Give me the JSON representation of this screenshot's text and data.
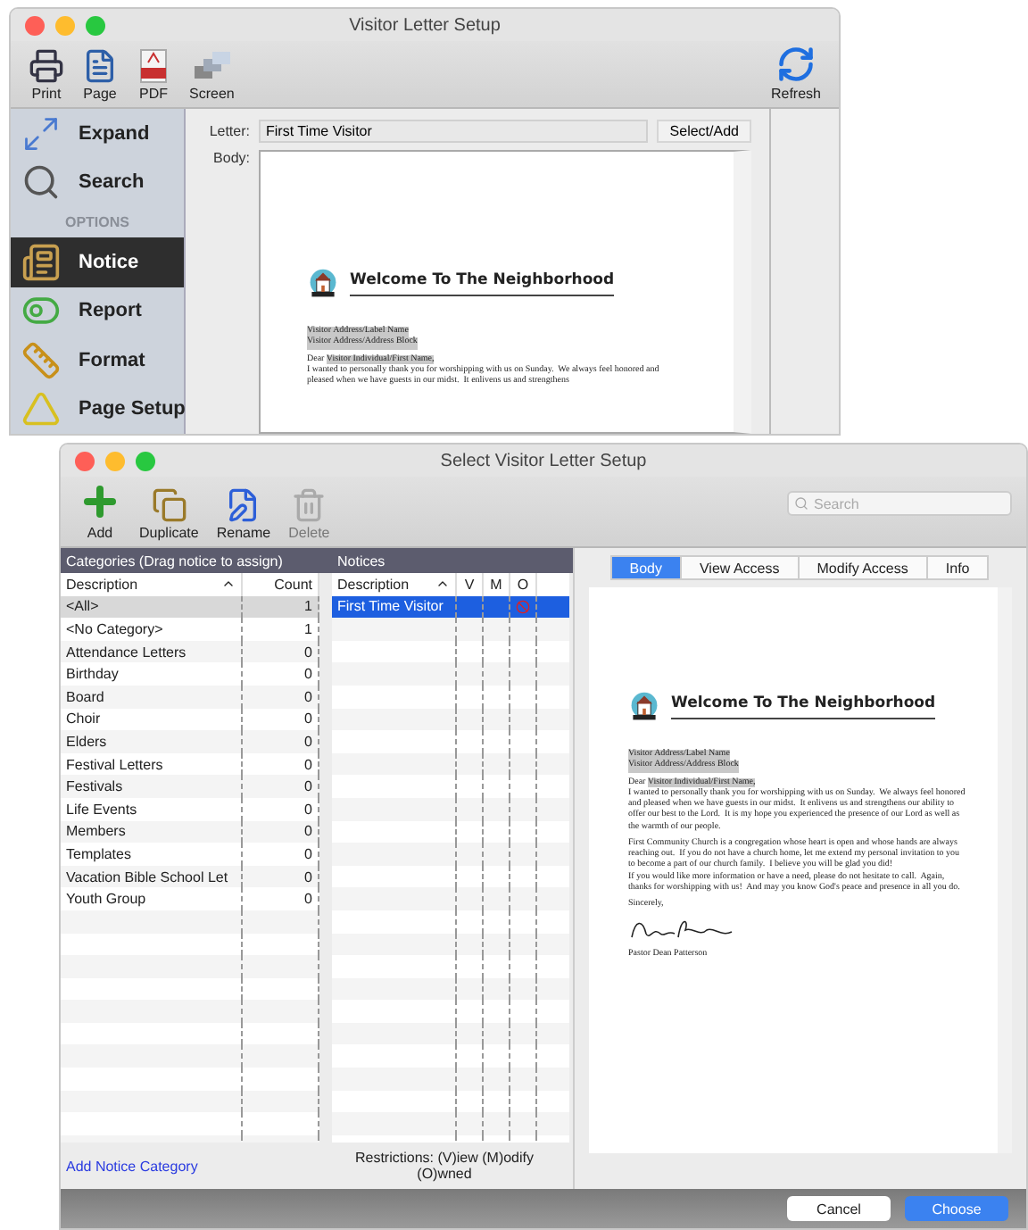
{
  "back_window": {
    "title": "Visitor Letter Setup",
    "toolbar": [
      {
        "label": "Print",
        "kind": "print"
      },
      {
        "label": "Page",
        "kind": "page"
      },
      {
        "label": "PDF",
        "kind": "pdf"
      },
      {
        "label": "Screen",
        "kind": "screen"
      }
    ],
    "refresh": {
      "label": "Refresh"
    },
    "sidebar": [
      {
        "kind": "expand",
        "label": "Expand",
        "selected": false
      },
      {
        "kind": "search",
        "label": "Search",
        "selected": false
      },
      {
        "kind": "header",
        "label": "OPTIONS"
      },
      {
        "kind": "notice",
        "label": "Notice",
        "selected": true
      },
      {
        "kind": "report",
        "label": "Report",
        "selected": false
      },
      {
        "kind": "format",
        "label": "Format",
        "selected": false
      },
      {
        "kind": "pagesetup",
        "label": "Page Setup",
        "selected": false
      }
    ],
    "letter_field": {
      "label": "Letter:",
      "value": "First Time Visitor"
    },
    "select_button": "Select/Add",
    "body_label": "Body:",
    "document": {
      "heading": "Welcome To The Neighborhood",
      "address_lines": [
        "Visitor Address/Label Name",
        "Visitor Address/Address Block"
      ],
      "greeting_prefix": "Dear",
      "greeting_field": "Visitor Individual/First Name,",
      "paragraphs": [
        "I wanted to personally thank you for worshipping with us on Sunday.  We always feel honored and pleased when we have guests in our midst.  It enlivens us and strengthens"
      ]
    }
  },
  "front_window": {
    "title": "Select Visitor Letter Setup",
    "toolbar": [
      {
        "label": "Add",
        "kind": "add",
        "disabled": false
      },
      {
        "label": "Duplicate",
        "kind": "duplicate",
        "disabled": false
      },
      {
        "label": "Rename",
        "kind": "rename",
        "disabled": false
      },
      {
        "label": "Delete",
        "kind": "delete",
        "disabled": true
      }
    ],
    "search": {
      "placeholder": "Search"
    },
    "categories": {
      "header": "Categories (Drag notice to assign)",
      "columns": [
        "Description",
        "Count"
      ],
      "rows": [
        {
          "description": "<All>",
          "count": "1",
          "selected": true
        },
        {
          "description": "<No Category>",
          "count": "1",
          "selected": false
        },
        {
          "description": "Attendance Letters",
          "count": "0",
          "selected": false
        },
        {
          "description": "Birthday",
          "count": "0",
          "selected": false
        },
        {
          "description": "Board",
          "count": "0",
          "selected": false
        },
        {
          "description": "Choir",
          "count": "0",
          "selected": false
        },
        {
          "description": "Elders",
          "count": "0",
          "selected": false
        },
        {
          "description": "Festival Letters",
          "count": "0",
          "selected": false
        },
        {
          "description": "Festivals",
          "count": "0",
          "selected": false
        },
        {
          "description": "Life Events",
          "count": "0",
          "selected": false
        },
        {
          "description": "Members",
          "count": "0",
          "selected": false
        },
        {
          "description": "Templates",
          "count": "0",
          "selected": false
        },
        {
          "description": "Vacation Bible School Let",
          "count": "0",
          "selected": false
        },
        {
          "description": "Youth Group",
          "count": "0",
          "selected": false
        }
      ]
    },
    "notices": {
      "header": "Notices",
      "columns": [
        "Description",
        "V",
        "M",
        "O"
      ],
      "rows": [
        {
          "description": "First Time Visitor",
          "selected": true,
          "view": false,
          "modify": false,
          "owned": true
        }
      ]
    },
    "tabs": [
      {
        "label": "Body",
        "selected": true
      },
      {
        "label": "View Access",
        "selected": false
      },
      {
        "label": "Modify Access",
        "selected": false
      },
      {
        "label": "Info",
        "selected": false
      }
    ],
    "document": {
      "heading": "Welcome To The Neighborhood",
      "address_lines": [
        "Visitor Address/Label Name",
        "Visitor Address/Address Block"
      ],
      "greeting_prefix": "Dear",
      "greeting_field": "Visitor Individual/First Name,",
      "paragraphs": [
        "I wanted to personally thank you for worshipping with us on Sunday.  We always feel honored and pleased when we have guests in our midst.  It enlivens us and strengthens our ability to offer our best to the Lord.  It is my hope you experienced the presence of our Lord as well as the warmth of our people.",
        "First Community Church is a congregation whose heart is open and whose hands are always reaching out.  If you do not have a church home, let me extend my personal invitation to you to become a part of our church family.  I believe you will be glad you did!\nIf you would like more information or have a need, please do not hesitate to call.  Again, thanks for worshipping with us!  And may you know God's peace and presence in all you do."
      ],
      "closing": "Sincerely,",
      "signer": "Pastor Dean Patterson"
    },
    "add_category_link": "Add Notice Category",
    "restrictions_note": "Restrictions: (V)iew (M)odify (O)wned",
    "buttons": [
      {
        "label": "Cancel",
        "kind": "default"
      },
      {
        "label": "Choose",
        "kind": "primary"
      }
    ]
  }
}
